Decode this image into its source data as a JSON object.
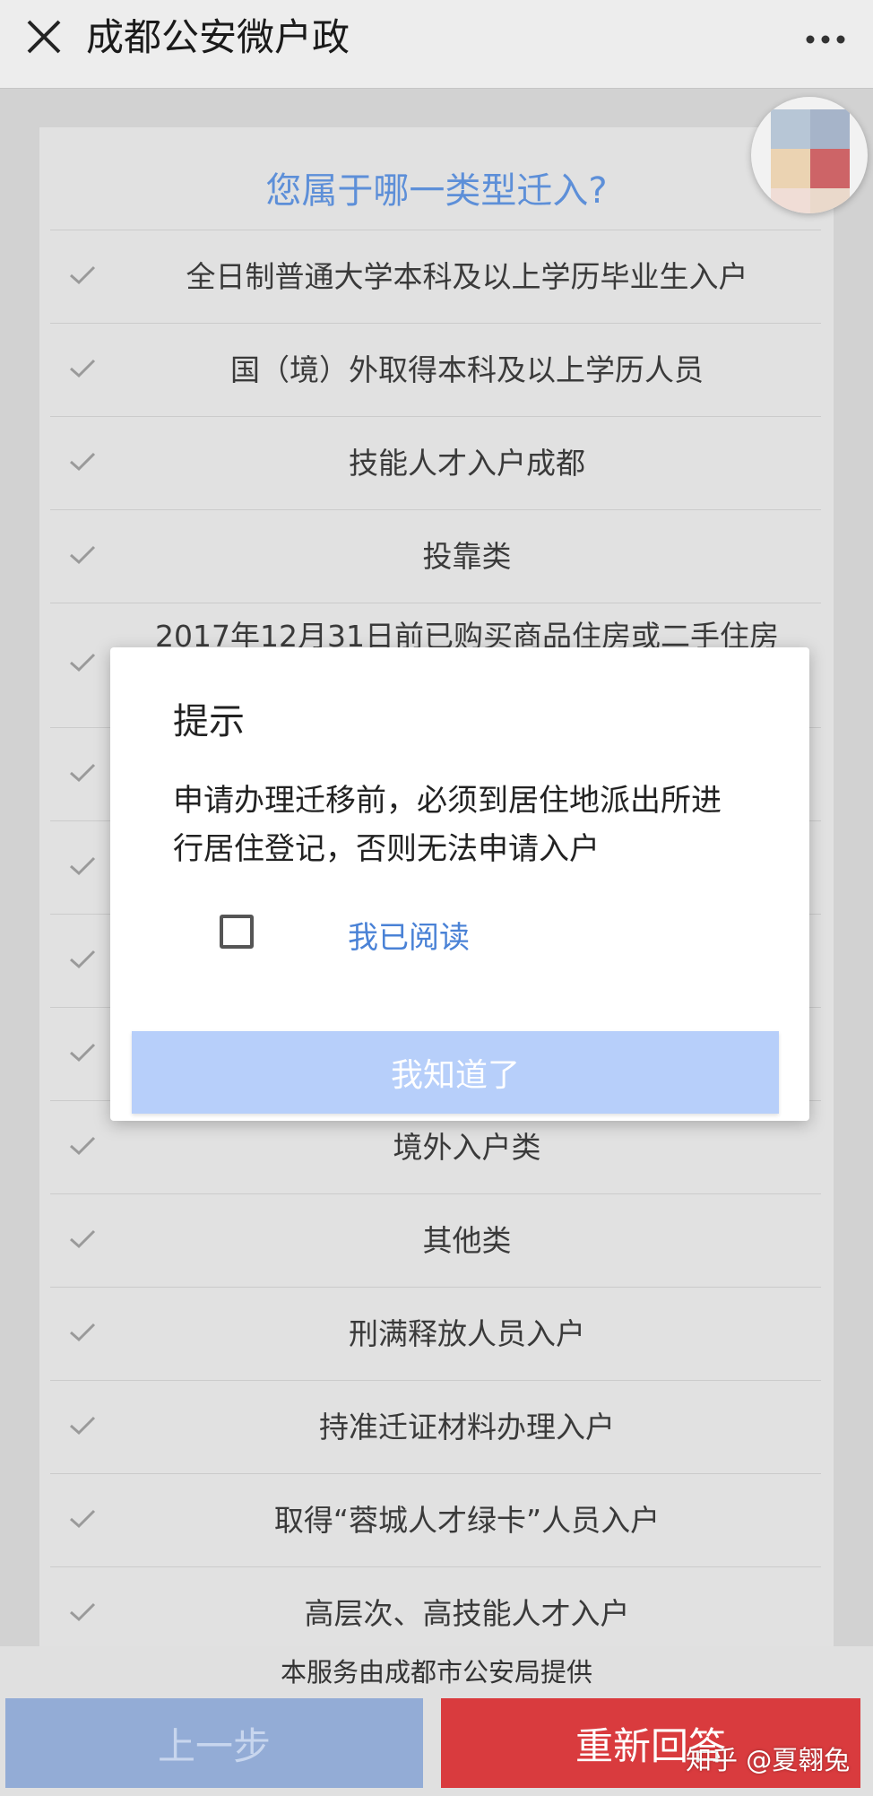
{
  "nav": {
    "title": "成都公安微户政"
  },
  "card": {
    "title": "您属于哪一类型迁入?"
  },
  "list": [
    "全日制普通大学本科及以上学历毕业生入户",
    "国（境）外取得本科及以上学历人员",
    "技能人才入户成都",
    "投靠类",
    "2017年12月31日前已购买商品住房或二手住房",
    "",
    "",
    "",
    "",
    "境外入户类",
    "其他类",
    "刑满释放人员入户",
    "持准迁证材料办理入户",
    "取得“蓉城人才绿卡”人员入户",
    "高层次、高技能人才入户"
  ],
  "dialog": {
    "title": "提示",
    "message": "申请办理迁移前，必须到居住地派出所进行居住登记，否则无法申请入户",
    "checkbox_label": "我已阅读",
    "checkbox_checked": false,
    "ok_label": "我知道了"
  },
  "footer": {
    "provider": "本服务由成都市公安局提供",
    "prev_label": "上一步",
    "reset_label": "重新回答"
  },
  "watermark": "知乎 @夏翱兔",
  "colors": {
    "accent_blue": "#5d8fd8",
    "reset_red": "#d93b3e",
    "prev_blue": "#93acd6",
    "ok_button": "#b7cffa"
  }
}
